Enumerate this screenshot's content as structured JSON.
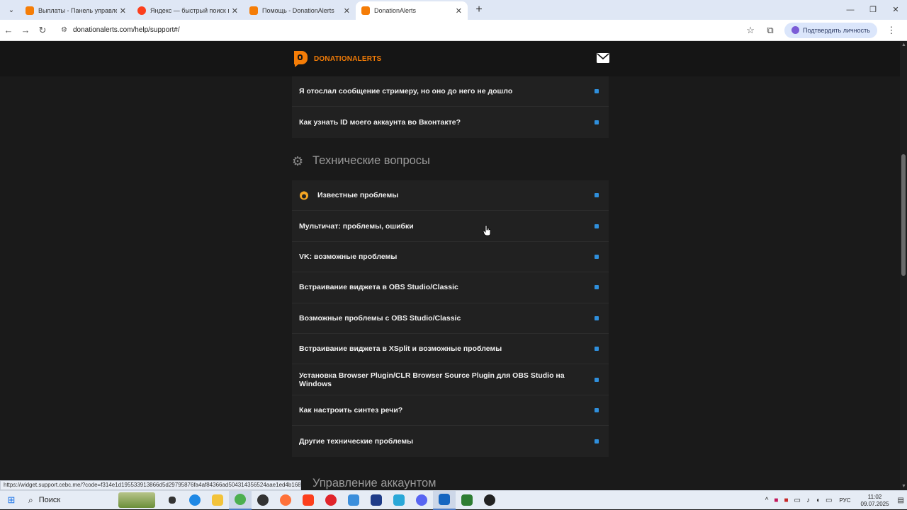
{
  "browser": {
    "tabs": [
      {
        "title": "Выплаты - Панель управлени",
        "icon": "donationalerts-favicon",
        "active": false
      },
      {
        "title": "Яндекс — быстрый поиск в и",
        "icon": "yandex-favicon",
        "active": false
      },
      {
        "title": "Помощь - DonationAlerts",
        "icon": "donationalerts-favicon",
        "active": false
      },
      {
        "title": "DonationAlerts",
        "icon": "donationalerts-favicon",
        "active": true
      }
    ],
    "url": "donationalerts.com/help/support#/",
    "verify_label": "Подтвердить личность",
    "status_url": "https://widget.support.cebc.me/?code=f314e1d195533913866d5d29795876fa4af84366ad504314356524aae1ed4b168..."
  },
  "site": {
    "brand": "DONATIONALERTS",
    "accent": "#f57d07",
    "link_arrow_color": "#2f8fdc"
  },
  "faq_top": [
    "Я отослал сообщение стримеру, но оно до него не дошло",
    "Как узнать ID моего аккаунта во Вконтакте?"
  ],
  "sections": {
    "tech_title": "Технические вопросы",
    "account_title": "Управление аккаунтом"
  },
  "faq_tech": [
    "Известные проблемы",
    "Мультичат: проблемы, ошибки",
    "VK: возможные проблемы",
    "Встраивание виджета в OBS Studio/Classic",
    "Возможные проблемы с OBS Studio/Classic",
    "Встраивание виджета в XSplit и возможные проблемы",
    "Установка Browser Plugin/CLR Browser Source Plugin для OBS Studio на Windows",
    "Как настроить синтез речи?",
    "Другие технические проблемы"
  ],
  "taskbar": {
    "search_label": "Поиск",
    "lang": "РУС",
    "time": "11:02",
    "date": "09.07.2025",
    "notif_count": "3"
  }
}
